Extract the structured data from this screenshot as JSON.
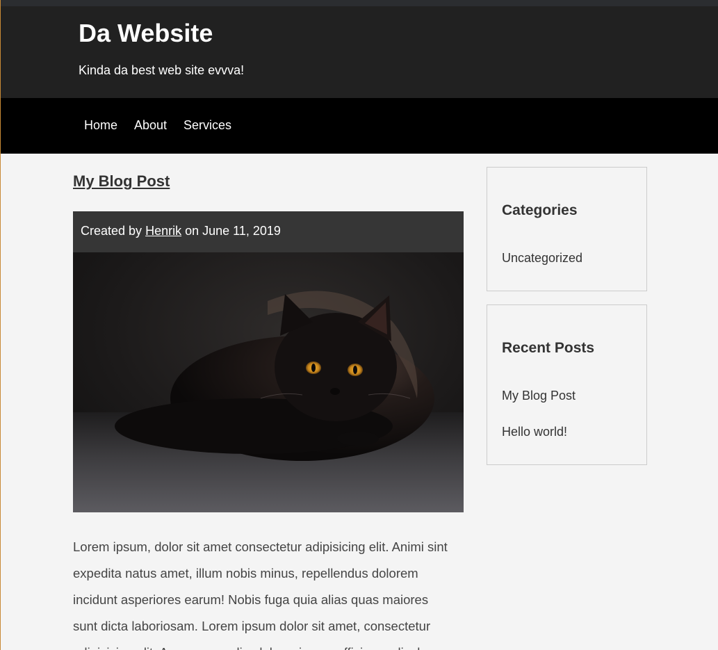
{
  "header": {
    "site_title": "Da Website",
    "tagline": "Kinda da best web site evvva!"
  },
  "nav": {
    "items": [
      {
        "label": "Home"
      },
      {
        "label": "About"
      },
      {
        "label": "Services"
      }
    ]
  },
  "post": {
    "title": "My Blog Post",
    "meta_prefix": "Created by",
    "author": "Henrik",
    "meta_suffix": "on June 11, 2019",
    "image_alt": "black cat",
    "body_lines": [
      "Lorem ipsum, dolor sit amet consectetur adipisicing elit. Animi sint",
      "expedita natus amet, illum nobis minus, repellendus dolorem",
      "incidunt asperiores earum! Nobis fuga quia alias quas maiores",
      "sunt dicta laboriosam. Lorem ipsum dolor sit amet, consectetur",
      "adipisicing elit. Accusamus alias labore ipsam officia, explicabo"
    ]
  },
  "sidebar": {
    "categories": {
      "title": "Categories",
      "items": [
        {
          "label": "Uncategorized"
        }
      ]
    },
    "recent_posts": {
      "title": "Recent Posts",
      "items": [
        {
          "label": "My Blog Post"
        },
        {
          "label": "Hello world!"
        }
      ]
    }
  },
  "colors": {
    "header_bg": "#212121",
    "nav_bg": "#000000",
    "page_bg": "#f4f4f4",
    "meta_bar_bg": "#363636"
  }
}
